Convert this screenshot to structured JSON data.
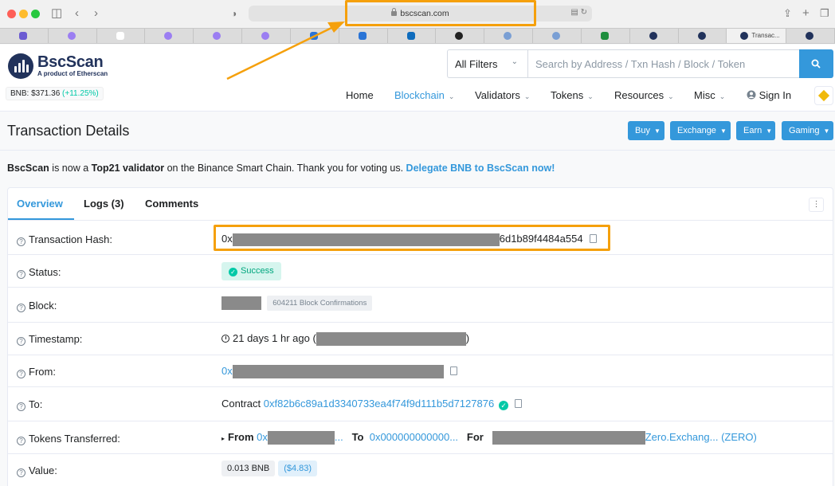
{
  "browser": {
    "url": "bscscan.com",
    "active_tab_title": "Transac..."
  },
  "header": {
    "logo_name": "BscScan",
    "logo_sub": "A product of Etherscan",
    "price_label": "BNB: $371.36",
    "price_change": "(+11.25%)",
    "filter_label": "All Filters",
    "search_placeholder": "Search by Address / Txn Hash / Block / Token",
    "nav": {
      "home": "Home",
      "blockchain": "Blockchain",
      "validators": "Validators",
      "tokens": "Tokens",
      "resources": "Resources",
      "misc": "Misc",
      "signin": "Sign In"
    }
  },
  "page": {
    "title": "Transaction Details",
    "buttons": {
      "buy": "Buy",
      "exchange": "Exchange",
      "earn": "Earn",
      "gaming": "Gaming"
    },
    "notice": {
      "brand": "BscScan",
      "mid1": "is now a",
      "bold": "Top21 validator",
      "mid2": "on the Binance Smart Chain. Thank you for voting us.",
      "link": "Delegate BNB to BscScan now!"
    }
  },
  "card": {
    "tabs": {
      "overview": "Overview",
      "logs": "Logs (3)",
      "comments": "Comments"
    },
    "labels": {
      "hash": "Transaction Hash:",
      "status": "Status:",
      "block": "Block:",
      "timestamp": "Timestamp:",
      "from": "From:",
      "to": "To:",
      "tokens": "Tokens Transferred:",
      "value": "Value:"
    },
    "values": {
      "hash_prefix": "0x",
      "hash_suffix": "6d1b89f4484a554",
      "status": "Success",
      "confirmations": "604211 Block Confirmations",
      "timestamp_ago": "21 days 1 hr ago (",
      "timestamp_close": ")",
      "from_prefix": "0x",
      "to_word": "Contract",
      "to_address": "0xf82b6c89a1d3340733ea4f74f9d111b5d7127876",
      "tt_from_word": "From",
      "tt_from_prefix": "0x",
      "tt_from_ellipsis": "...",
      "tt_to_word": "To",
      "tt_to_address": "0x000000000000...",
      "tt_for_word": "For",
      "tt_token": "Zero.Exchang... (ZERO)",
      "value_bnb": "0.013 BNB",
      "value_usd": "($4.83)"
    }
  },
  "colors": {
    "accent": "#3498db",
    "success": "#00c9a7",
    "annotation": "#f5a00c",
    "navy": "#21325b"
  }
}
